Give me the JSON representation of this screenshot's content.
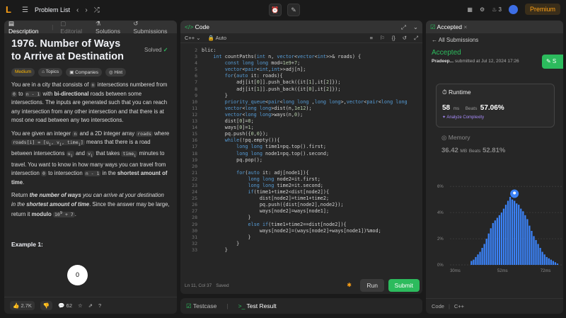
{
  "topbar": {
    "problem_list": "Problem List",
    "streak": "3",
    "premium": "Premium"
  },
  "left": {
    "tabs": [
      "Description",
      "Editorial",
      "Solutions",
      "Submissions"
    ],
    "title": "1976. Number of Ways to Arrive at Destination",
    "status": "Solved",
    "tags": [
      "Medium",
      "Topics",
      "Companies",
      "Hint"
    ],
    "p1": "You are in a city that consists of n intersections numbered from 0 to n - 1 with bi-directional roads between some intersections. The inputs are generated such that you can reach any intersection from any other intersection and that there is at most one road between any two intersections.",
    "p2": "You are given an integer n and a 2D integer array roads where roads[i] = [ui, vi, timei] means that there is a road between intersections ui and vi that takes timei minutes to travel. You want to know in how many ways you can travel from intersection 0 to intersection n - 1 in the shortest amount of time.",
    "p3": "Return the number of ways you can arrive at your destination in the shortest amount of time. Since the answer may be large, return it modulo 10⁹ + 7.",
    "example": "Example 1:",
    "overlay_badge": "0",
    "footer": {
      "likes": "2.7K",
      "comments": "62"
    }
  },
  "code": {
    "tab": "Code",
    "lang": "C++",
    "mode": "Auto",
    "status": "Ln 11, Col 37",
    "saved": "Saved",
    "run": "Run",
    "submit": "Submit",
    "lines": [
      "blic:",
      "    int countPaths(int n, vector<vector<int>>& roads) {",
      "        const long long mod=1e9+7;",
      "        vector<pair<int,int>>adj[n];",
      "        for(auto it: roads){",
      "            adj[it[0]].push_back({it[1],it[2]});",
      "            adj[it[1]].push_back({it[0],it[2]});",
      "        }",
      "        priority_queue<pair<long long ,long long>,vector<pair<long long",
      "        vector<long long>dist(n,1e12);",
      "        vector<long long>ways(n,0);",
      "        dist[0]=0;",
      "        ways[0]=1;",
      "        pq.push({0,0});",
      "        while(!pq.empty()){",
      "            long long time1=pq.top().first;",
      "            long long node1=pq.top().second;",
      "            pq.pop();",
      "",
      "            for(auto it: adj[node1]){",
      "                long long node2=it.first;",
      "                long long time2=it.second;",
      "                if(time1+time2<dist[node2]){",
      "                    dist[node2]=time1+time2;",
      "                    pq.push({dist[node2],node2});",
      "                    ways[node2]=ways[node1];",
      "                }",
      "                else if(time1+time2==dist[node2]){",
      "                    ways[node2]=(ways[node2]+ways[node1])%mod;",
      "                }",
      "            }",
      "        }"
    ],
    "line_numbers": [
      "2",
      "3",
      "4",
      "5",
      "6",
      "7",
      "8",
      "9",
      "10",
      "11",
      "12",
      "13",
      "14",
      "15",
      "16",
      "17",
      "18",
      "19",
      "20",
      "21",
      "22",
      "23",
      "24",
      "25",
      "26",
      "27",
      "28",
      "29",
      "30",
      "31",
      "32",
      "33"
    ]
  },
  "testpanel": {
    "testcase": "Testcase",
    "result": "Test Result"
  },
  "right": {
    "tab": "Accepted",
    "back": "All Submissions",
    "accepted": "Accepted",
    "user": "Pradeep...",
    "submitted": "submitted at Jul 12, 2024 17:26",
    "runtime_label": "Runtime",
    "runtime_value": "58",
    "runtime_unit": "ms",
    "beats_label": "Beats",
    "runtime_beats": "57.06%",
    "analyze": "Analyze Complexity",
    "memory_label": "Memory",
    "memory_value": "36.42",
    "memory_unit": "MB",
    "memory_beats": "52.81%",
    "footer_label": "Code",
    "footer_lang": "C++"
  },
  "chart_data": {
    "type": "bar",
    "ytick_labels": [
      "6%",
      "4%",
      "2%",
      "0%"
    ],
    "xtick_labels": [
      "30ms",
      "52ms",
      "72ms"
    ],
    "xtick_values": [
      30,
      52,
      72
    ],
    "yticks": [
      6,
      4,
      2,
      0
    ],
    "ylim": [
      0,
      6.5
    ],
    "xlim": [
      28,
      80
    ],
    "highlight": 58,
    "x": [
      38,
      39,
      40,
      41,
      42,
      43,
      44,
      45,
      46,
      47,
      48,
      49,
      50,
      51,
      52,
      53,
      54,
      55,
      56,
      57,
      58,
      59,
      60,
      61,
      62,
      63,
      64,
      65,
      66,
      67,
      68,
      69,
      70,
      71,
      72,
      73,
      74,
      75,
      76,
      77,
      78
    ],
    "values": [
      0.3,
      0.4,
      0.6,
      0.8,
      1.0,
      1.3,
      1.6,
      2.0,
      2.4,
      2.8,
      3.2,
      3.4,
      3.6,
      3.8,
      4.0,
      4.3,
      4.6,
      4.9,
      5.2,
      5.0,
      4.9,
      4.7,
      4.6,
      4.3,
      4.1,
      3.8,
      3.5,
      3.0,
      2.6,
      2.2,
      1.9,
      1.6,
      1.3,
      1.0,
      0.8,
      0.6,
      0.5,
      0.4,
      0.3,
      0.2,
      0.1
    ]
  }
}
